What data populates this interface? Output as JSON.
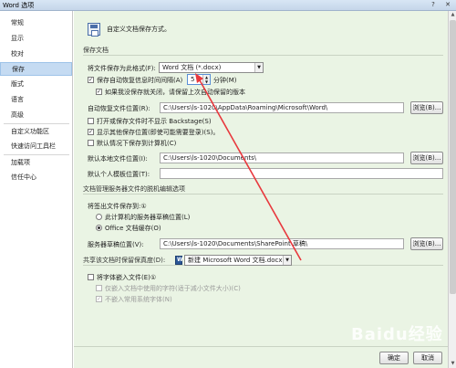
{
  "window": {
    "title": "Word 选项",
    "help": "?",
    "close": "✕"
  },
  "sidebar": {
    "items": [
      {
        "label": "常规"
      },
      {
        "label": "显示"
      },
      {
        "label": "校对"
      },
      {
        "label": "保存"
      },
      {
        "label": "版式"
      },
      {
        "label": "语言"
      },
      {
        "label": "高级"
      },
      {
        "label": "自定义功能区"
      },
      {
        "label": "快速访问工具栏"
      },
      {
        "label": "加载项"
      },
      {
        "label": "信任中心"
      }
    ]
  },
  "header": {
    "text": "自定义文档保存方式。"
  },
  "save_docs": {
    "section": "保存文档",
    "format_label": "将文件保存为此格式(F):",
    "format_value": "Word 文档 (*.docx)",
    "autorecover_label": "保存自动恢复信息时间间隔(A)",
    "autorecover_minutes": "5",
    "minutes_label": "分钟(M)",
    "keep_last_label": "如果我没保存就关闭，请保留上次自动保留的版本",
    "autorecover_location_label": "自动恢复文件位置(R):",
    "autorecover_location_value": "C:\\Users\\ls-1020\\AppData\\Roaming\\Microsoft\\Word\\",
    "browse1": "浏览(B)...",
    "no_backstage_label": "打开或保存文件时不显示 Backstage(S)",
    "show_other_locations_label": "显示其他保存位置(即使可能需要登录)(S)。",
    "save_to_computer_label": "默认情况下保存到计算机(C)",
    "default_local_label": "默认本地文件位置(I):",
    "default_local_value": "C:\\Users\\ls-1020\\Documents\\",
    "browse2": "浏览(B)...",
    "personal_templates_label": "默认个人模板位置(T):",
    "personal_templates_value": ""
  },
  "offline": {
    "section": "文档管理服务器文件的脱机编辑选项",
    "checkout_label": "将签出文件保存到:①",
    "radio1": "此计算机的服务器草稿位置(L)",
    "radio2": "Office 文档缓存(O)",
    "drafts_label": "服务器草稿位置(V):",
    "drafts_value": "C:\\Users\\ls-1020\\Documents\\SharePoint 草稿\\",
    "browse3": "浏览(B)..."
  },
  "fidelity": {
    "label": "共享该文档时保留保真度(D):",
    "doc_value": "新建 Microsoft Word 文档.docx",
    "embed_fonts": "将字体嵌入文件(E)①",
    "embed_used_only": "仅嵌入文档中使用的字符(适于减小文件大小)(C)",
    "no_common_fonts": "不嵌入常用系统字体(N)"
  },
  "footer": {
    "ok": "确定",
    "cancel": "取消"
  },
  "watermark": "Baidu经验"
}
